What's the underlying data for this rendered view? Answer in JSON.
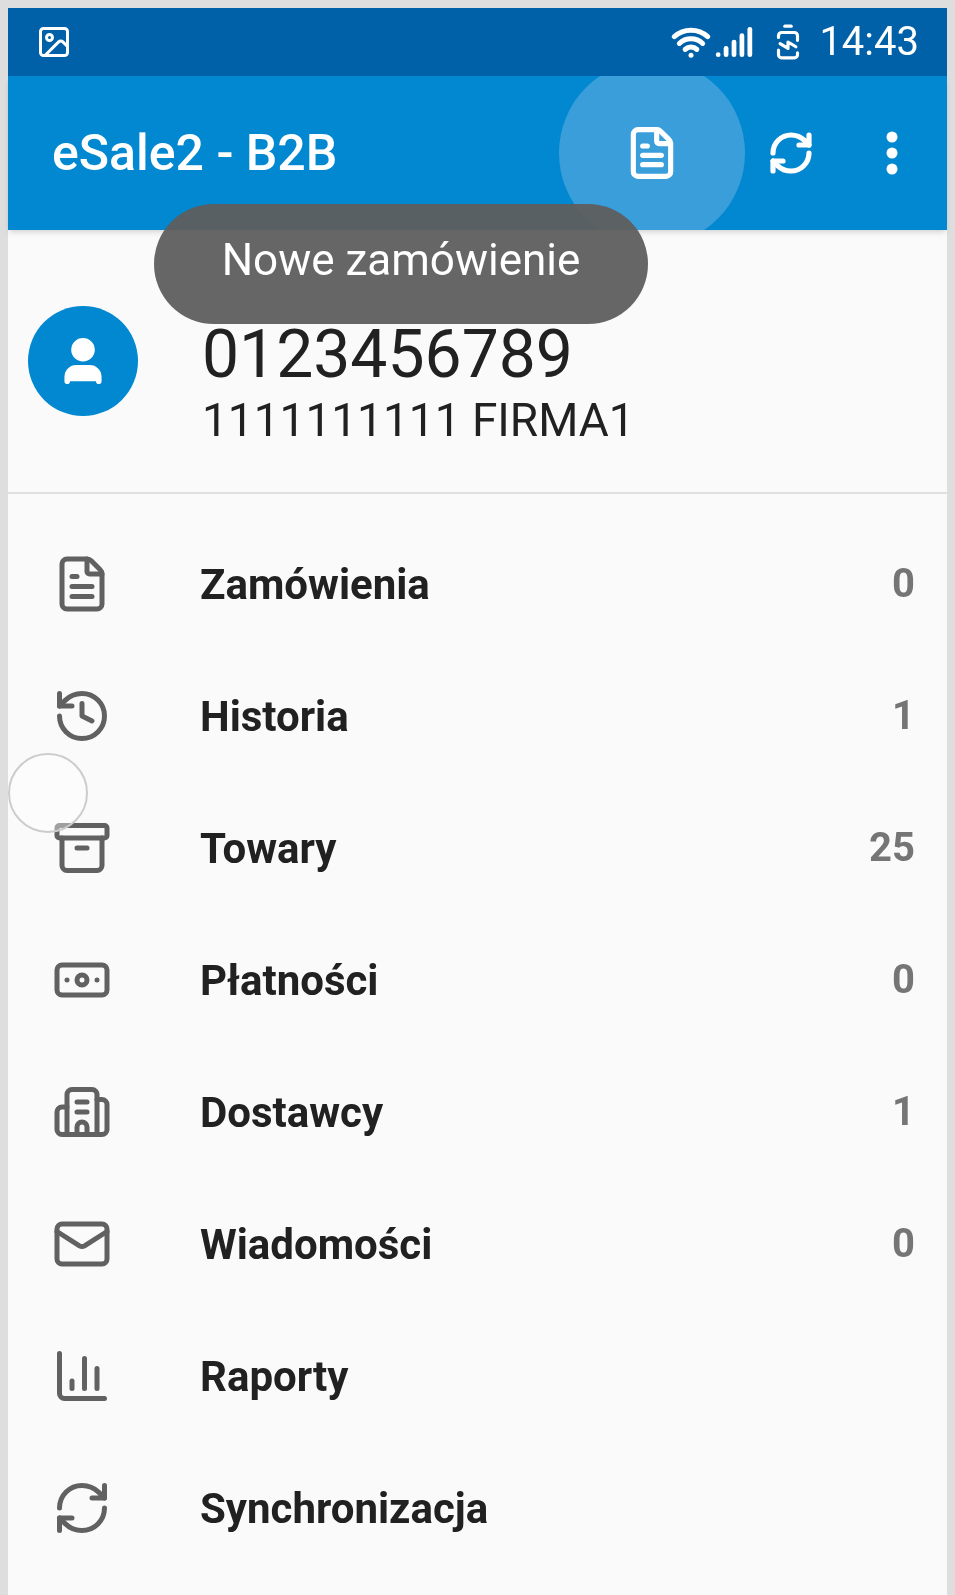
{
  "status_bar": {
    "time": "14:43"
  },
  "app_bar": {
    "title": "eSale2 - B2B"
  },
  "toast": {
    "text": "Nowe zamówienie"
  },
  "account": {
    "phone": "0123456789",
    "company": "1111111111 FIRMA1"
  },
  "menu": [
    {
      "label": "Zamówienia",
      "count": "0"
    },
    {
      "label": "Historia",
      "count": "1"
    },
    {
      "label": "Towary",
      "count": "25"
    },
    {
      "label": "Płatności",
      "count": "0"
    },
    {
      "label": "Dostawcy",
      "count": "1"
    },
    {
      "label": "Wiadomości",
      "count": "0"
    },
    {
      "label": "Raporty"
    },
    {
      "label": "Synchronizacja"
    }
  ]
}
